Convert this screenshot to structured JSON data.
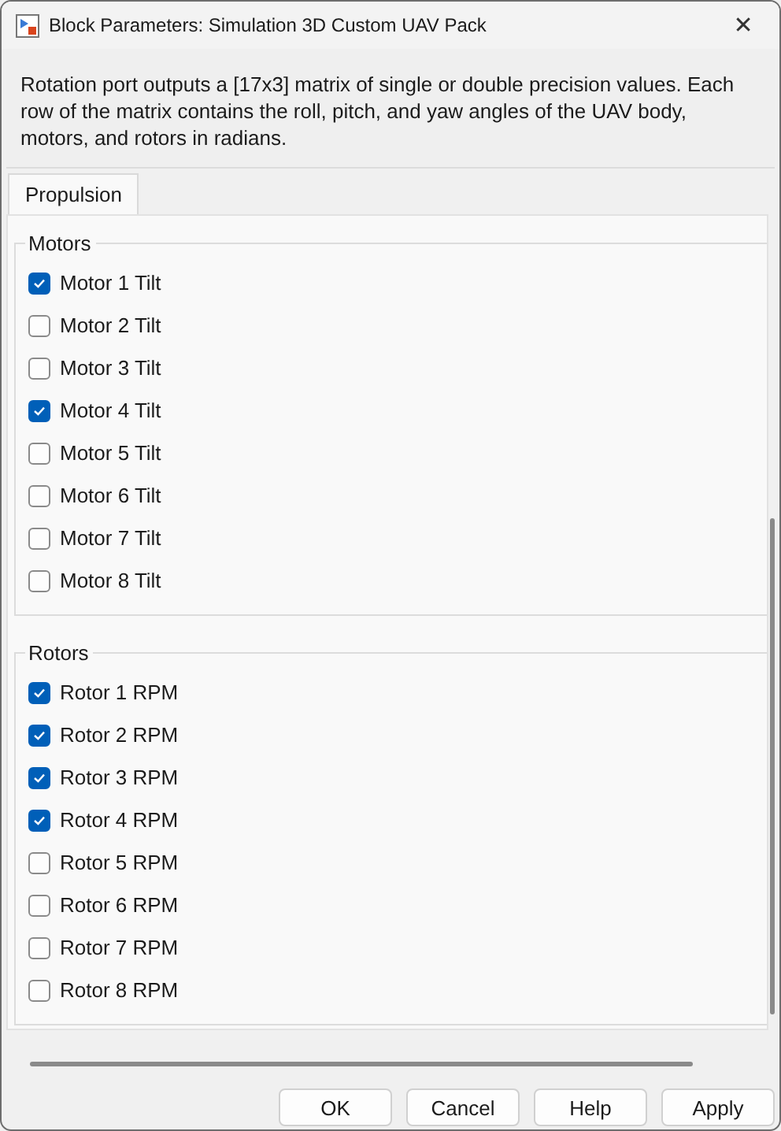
{
  "window": {
    "title": "Block Parameters: Simulation 3D Custom UAV Pack",
    "close": "✕"
  },
  "description": "Rotation port outputs a [17x3] matrix of single or double precision values. Each row of the matrix contains the roll, pitch, and yaw angles of the UAV body, motors, and rotors in radians.",
  "tabs": [
    {
      "label": "Propulsion",
      "selected": true
    }
  ],
  "groups": [
    {
      "title": "Motors",
      "items": [
        {
          "label": "Motor 1 Tilt",
          "checked": true
        },
        {
          "label": "Motor 2 Tilt",
          "checked": false
        },
        {
          "label": "Motor 3 Tilt",
          "checked": false
        },
        {
          "label": "Motor 4 Tilt",
          "checked": true
        },
        {
          "label": "Motor 5 Tilt",
          "checked": false
        },
        {
          "label": "Motor 6 Tilt",
          "checked": false
        },
        {
          "label": "Motor 7 Tilt",
          "checked": false
        },
        {
          "label": "Motor 8 Tilt",
          "checked": false
        }
      ]
    },
    {
      "title": "Rotors",
      "items": [
        {
          "label": "Rotor 1 RPM",
          "checked": true
        },
        {
          "label": "Rotor 2 RPM",
          "checked": true
        },
        {
          "label": "Rotor 3 RPM",
          "checked": true
        },
        {
          "label": "Rotor 4 RPM",
          "checked": true
        },
        {
          "label": "Rotor 5 RPM",
          "checked": false
        },
        {
          "label": "Rotor 6 RPM",
          "checked": false
        },
        {
          "label": "Rotor 7 RPM",
          "checked": false
        },
        {
          "label": "Rotor 8 RPM",
          "checked": false
        }
      ]
    }
  ],
  "buttons": [
    "OK",
    "Cancel",
    "Help",
    "Apply"
  ]
}
